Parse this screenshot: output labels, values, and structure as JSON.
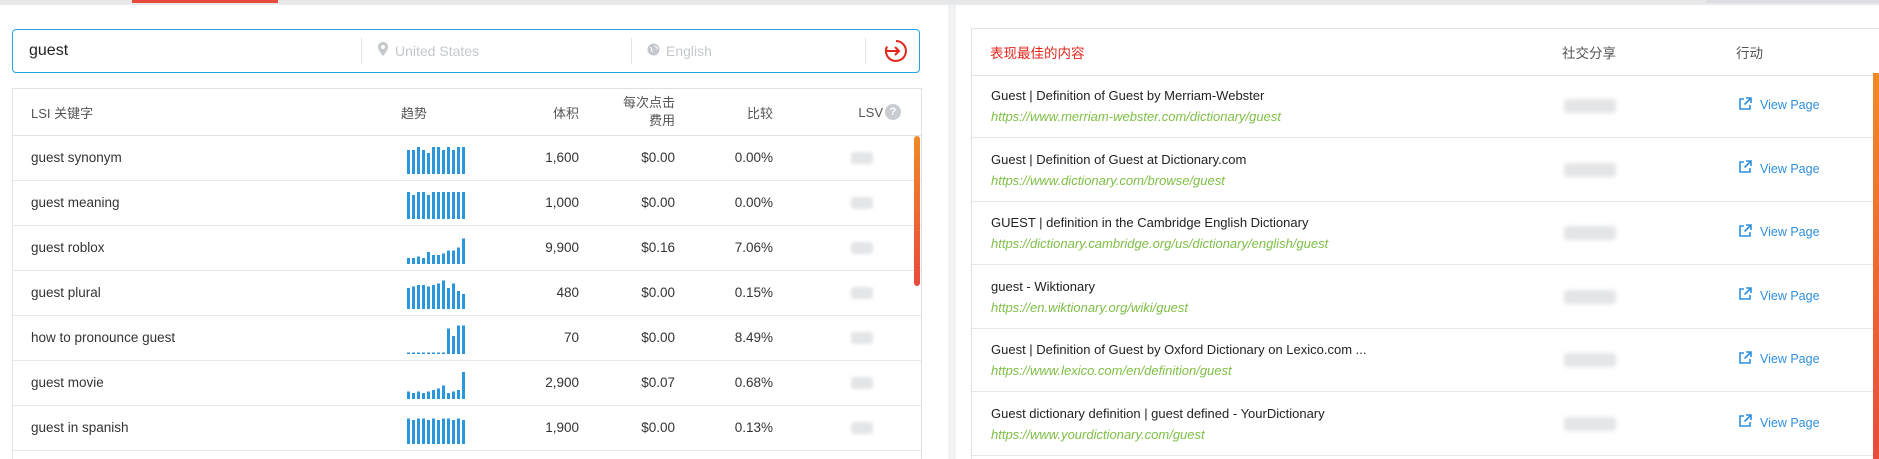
{
  "search": {
    "keyword": "guest",
    "country_placeholder": "United States",
    "language_placeholder": "English",
    "icons": {
      "location": "map-pin-icon",
      "language": "globe-icon",
      "submit": "sign-in-arrow-icon"
    }
  },
  "lsi_table": {
    "headers": {
      "keyword": "LSI 关键字",
      "trend": "趋势",
      "volume": "体积",
      "cpc": "每次点击\n费用",
      "compare": "比较",
      "lsv": "LSV",
      "help": "?"
    },
    "rows": [
      {
        "keyword": "guest synonym",
        "trend": [
          0.8,
          0.8,
          0.9,
          0.8,
          0.7,
          0.9,
          0.9,
          0.8,
          0.9,
          0.8,
          0.9,
          0.9
        ],
        "volume": "1,600",
        "cpc": "$0.00",
        "compare": "0.00%"
      },
      {
        "keyword": "guest meaning",
        "trend": [
          0.9,
          0.8,
          0.9,
          0.9,
          0.8,
          0.9,
          0.9,
          0.9,
          0.9,
          0.9,
          0.9,
          0.9
        ],
        "volume": "1,000",
        "cpc": "$0.00",
        "compare": "0.00%"
      },
      {
        "keyword": "guest roblox",
        "trend": [
          0.2,
          0.2,
          0.25,
          0.2,
          0.4,
          0.3,
          0.3,
          0.35,
          0.45,
          0.45,
          0.55,
          0.85
        ],
        "volume": "9,900",
        "cpc": "$0.16",
        "compare": "7.06%"
      },
      {
        "keyword": "guest plural",
        "trend": [
          0.7,
          0.75,
          0.8,
          0.8,
          0.75,
          0.8,
          0.85,
          0.95,
          0.7,
          0.85,
          0.6,
          0.5
        ],
        "volume": "480",
        "cpc": "$0.00",
        "compare": "0.15%"
      },
      {
        "keyword": "how to pronounce guest",
        "trend": [
          0.05,
          0.05,
          0.05,
          0.05,
          0.05,
          0.05,
          0.05,
          0.05,
          0.85,
          0.6,
          0.95,
          0.95
        ],
        "volume": "70",
        "cpc": "$0.00",
        "compare": "8.49%"
      },
      {
        "keyword": "guest movie",
        "trend": [
          0.25,
          0.2,
          0.25,
          0.2,
          0.25,
          0.3,
          0.35,
          0.45,
          0.2,
          0.25,
          0.3,
          0.9
        ],
        "volume": "2,900",
        "cpc": "$0.07",
        "compare": "0.68%"
      },
      {
        "keyword": "guest in spanish",
        "trend": [
          0.85,
          0.8,
          0.85,
          0.85,
          0.8,
          0.85,
          0.8,
          0.85,
          0.85,
          0.8,
          0.85,
          0.8
        ],
        "volume": "1,900",
        "cpc": "$0.00",
        "compare": "0.13%"
      }
    ]
  },
  "top_content": {
    "headers": {
      "title": "表现最佳的内容",
      "social": "社交分享",
      "action": "行动"
    },
    "view_label": "View Page",
    "view_icon": "external-link-icon",
    "rows": [
      {
        "title": "Guest | Definition of Guest by Merriam-Webster",
        "url": "https://www.merriam-webster.com/dictionary/guest"
      },
      {
        "title": "Guest | Definition of Guest at Dictionary.com",
        "url": "https://www.dictionary.com/browse/guest"
      },
      {
        "title": "GUEST | definition in the Cambridge English Dictionary",
        "url": "https://dictionary.cambridge.org/us/dictionary/english/guest"
      },
      {
        "title": "guest - Wiktionary",
        "url": "https://en.wiktionary.org/wiki/guest"
      },
      {
        "title": "Guest | Definition of Guest by Oxford Dictionary on Lexico.com ...",
        "url": "https://www.lexico.com/en/definition/guest"
      },
      {
        "title": "Guest dictionary definition | guest defined - YourDictionary",
        "url": "https://www.yourdictionary.com/guest"
      }
    ]
  },
  "colors": {
    "accent_blue": "#27a3e8",
    "accent_red": "#e84b3c",
    "trend_blue": "#2a96dc",
    "url_green": "#7dbf45",
    "link_blue": "#2f8fdc"
  }
}
